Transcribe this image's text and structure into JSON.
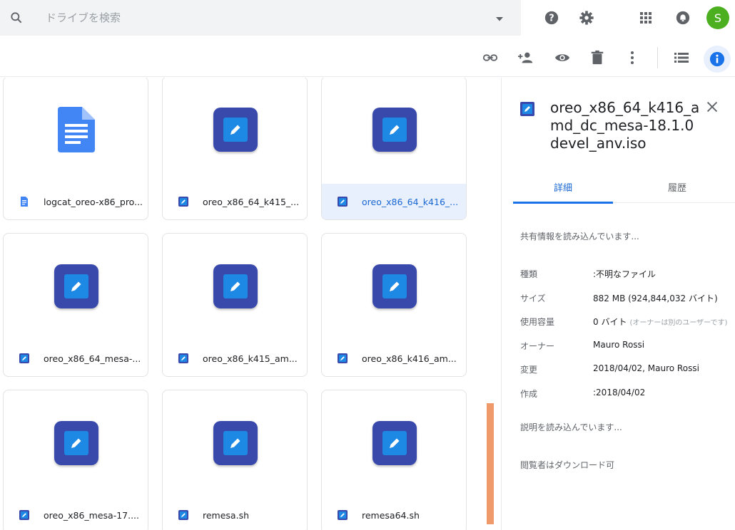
{
  "search": {
    "placeholder": "ドライブを検索"
  },
  "header": {
    "avatar_letter": "S"
  },
  "files": [
    {
      "name": "logcat_oreo-x86_pro...",
      "type": "doc",
      "selected": false
    },
    {
      "name": "oreo_x86_64_k415_...",
      "type": "generic",
      "selected": false
    },
    {
      "name": "oreo_x86_64_k416_...",
      "type": "generic",
      "selected": true
    },
    {
      "name": "oreo_x86_64_mesa-...",
      "type": "generic",
      "selected": false
    },
    {
      "name": "oreo_x86_k415_am...",
      "type": "generic",
      "selected": false
    },
    {
      "name": "oreo_x86_k416_am...",
      "type": "generic",
      "selected": false
    },
    {
      "name": "oreo_x86_mesa-17....",
      "type": "generic",
      "selected": false
    },
    {
      "name": "remesa.sh",
      "type": "generic",
      "selected": false
    },
    {
      "name": "remesa64.sh",
      "type": "generic",
      "selected": false
    }
  ],
  "details": {
    "title": "oreo_x86_64_k416_amd_dc_mesa-18.1.0devel_anv.iso",
    "tabs": [
      "詳細",
      "履歴"
    ],
    "sharing_loading": "共有情報を読み込んでいます...",
    "rows": [
      {
        "key": "種類",
        "value": ":不明なファイル",
        "note": ""
      },
      {
        "key": "サイズ",
        "value": "882 MB (924,844,032 バイト)",
        "note": ""
      },
      {
        "key": "使用容量",
        "value": "0 バイト",
        "note": "(オーナーは別のユーザーです)"
      },
      {
        "key": "オーナー",
        "value": "Mauro Rossi",
        "note": ""
      },
      {
        "key": "変更",
        "value": "2018/04/02, Mauro Rossi",
        "note": ""
      },
      {
        "key": "作成",
        "value": ":2018/04/02",
        "note": ""
      }
    ],
    "description_loading": "説明を読み込んでいます...",
    "download_note": "閲覧者はダウンロード可"
  },
  "colors": {
    "accent": "#1a73e8",
    "selected_bg": "#e8f0fe",
    "file_icon": "#3949ab",
    "avatar": "#4caf1f",
    "scrollbar": "#f09a6c"
  }
}
